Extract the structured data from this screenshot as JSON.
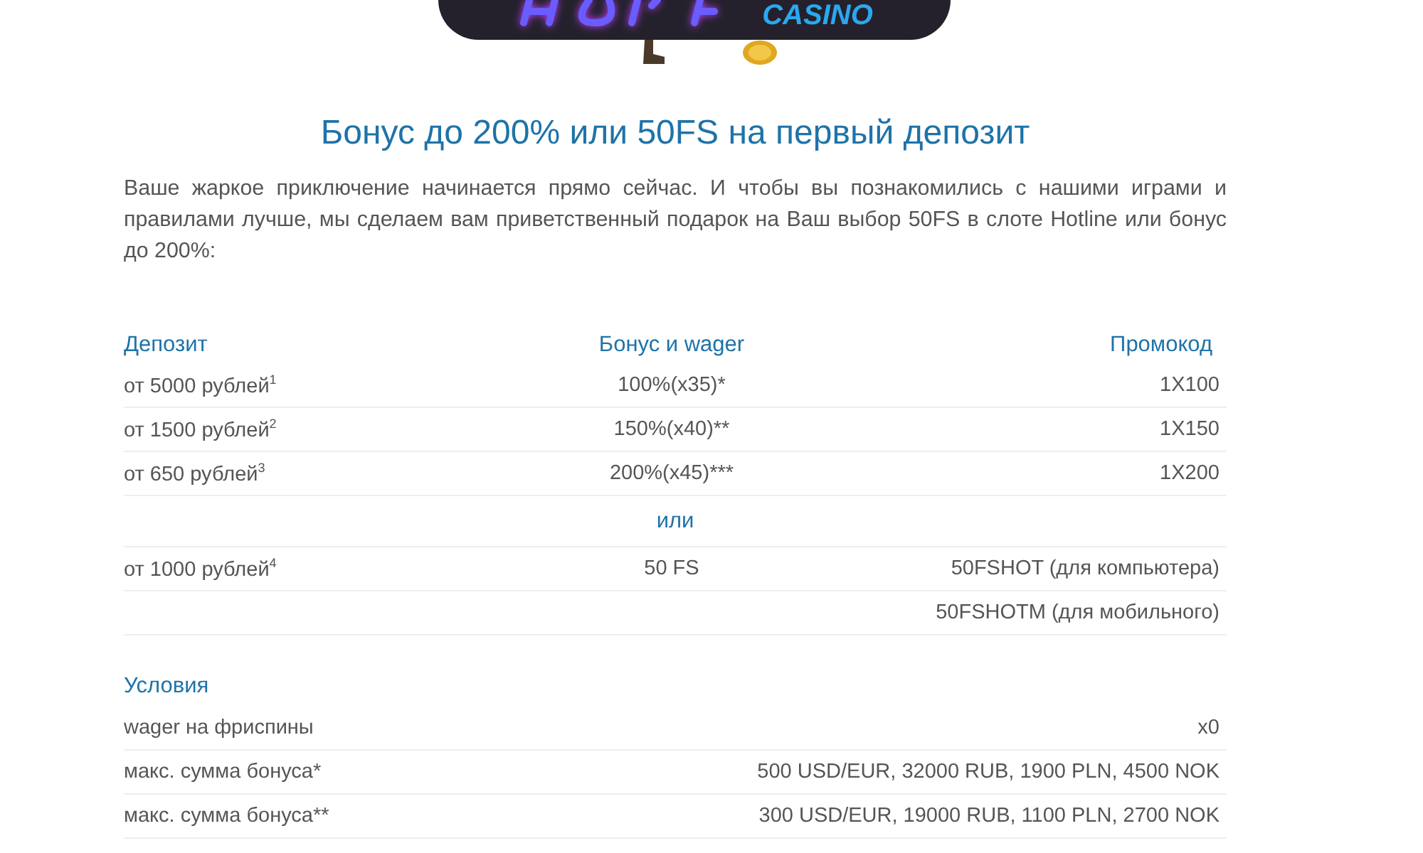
{
  "logo": {
    "text": "CASINO"
  },
  "title": "Бонус до 200% или 50FS на первый депозит",
  "intro": "Ваше жаркое приключение начинается прямо сейчас. И чтобы вы познакомились с нашими играми и правилами лучше, мы сделаем вам приветственный подарок на Ваш выбор 50FS в слоте Hotline или бонус до 200%:",
  "bonus_table": {
    "columns": [
      "Депозит",
      "Бонус и wager",
      "Промокод"
    ],
    "rows": [
      {
        "kind": "row",
        "deposit": "от 5000 рублей$^{1}$",
        "bonus": "100%(x35)*",
        "promo": "1X100"
      },
      {
        "kind": "row",
        "deposit": "от 1500 рублей$^{2}$",
        "bonus": "150%(x40)**",
        "promo": "1X150"
      },
      {
        "kind": "row",
        "deposit": "от 650 рублей$^{3}$",
        "bonus": "200%(x45)***",
        "promo": "1X200"
      },
      {
        "kind": "separator",
        "label": "или"
      },
      {
        "kind": "row",
        "deposit": "от 1000 рублей$^{4}$",
        "bonus": "50 FS",
        "promo": "50FSHOT (для компьютера)"
      },
      {
        "kind": "row",
        "promo": "50FSHOTM (для мобильного)"
      }
    ]
  },
  "conditions": {
    "title": "Условия",
    "rows": [
      {
        "label": "wager на фриспины",
        "value": "x0"
      },
      {
        "label": "макс. сумма бонуса*",
        "value": "500 USD/EUR, 32000 RUB, 1900 PLN, 4500 NOK"
      },
      {
        "label": "макс. сумма бонуса**",
        "value": "300 USD/EUR, 19000 RUB, 1100 PLN, 2700 NOK"
      }
    ]
  }
}
